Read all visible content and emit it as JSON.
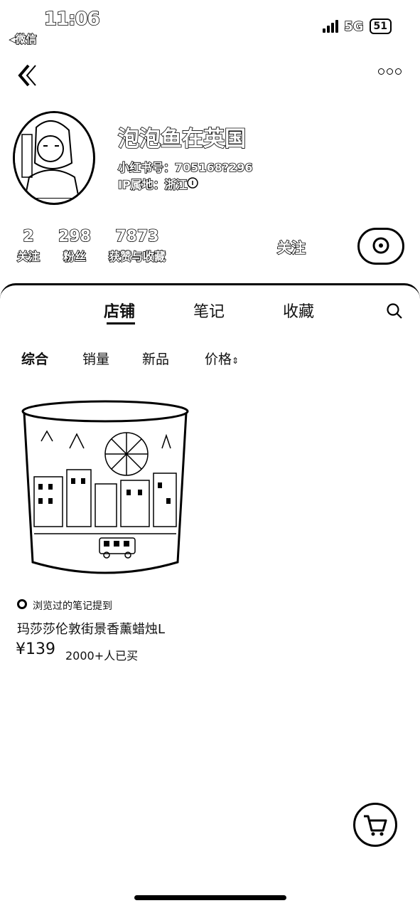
{
  "status_bar": {
    "time": "11:06",
    "back_app": "◂微信",
    "network": "5G",
    "battery": "51"
  },
  "profile": {
    "name": "泡泡鱼在英国",
    "redbook_id": "小红书号：705168?296",
    "ip_location": "IP属地：浙江",
    "stats": [
      {
        "value": "2",
        "label": "关注"
      },
      {
        "value": "298",
        "label": "粉丝"
      },
      {
        "value": "7873",
        "label": "获赞与收藏"
      }
    ],
    "follow_label": "关注"
  },
  "tabs": [
    {
      "label": "店铺",
      "active": true
    },
    {
      "label": "笔记",
      "active": false
    },
    {
      "label": "收藏",
      "active": false
    }
  ],
  "filters": [
    "综合",
    "销量",
    "新品",
    "价格"
  ],
  "filter_sort_glyph": "⇕",
  "product": {
    "badge": "浏览过的笔记提到",
    "title": "玛莎莎伦敦街景香薰蜡烛L",
    "price": "¥139",
    "sold": "2000+人已买"
  }
}
